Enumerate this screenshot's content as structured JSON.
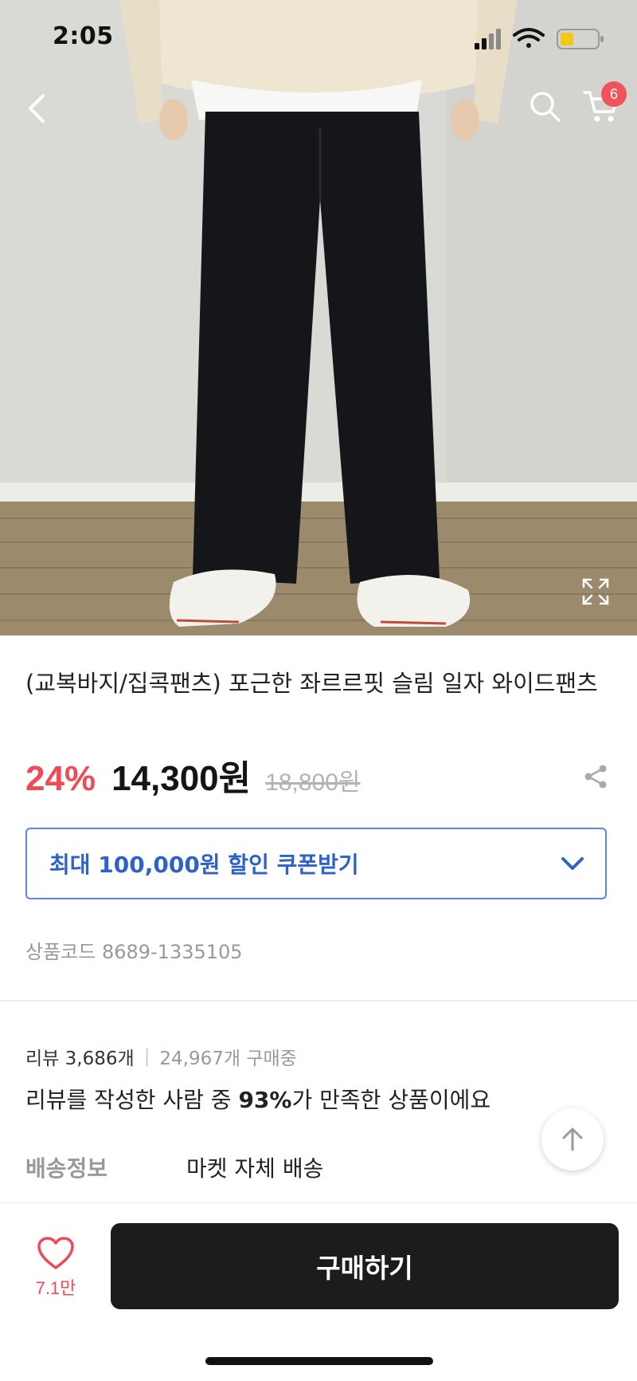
{
  "status_bar": {
    "time": "2:05"
  },
  "header": {
    "back_icon": "chevron-left-icon",
    "search_icon": "search-icon",
    "cart_icon": "cart-icon",
    "cart_count": "6"
  },
  "product": {
    "title": "(교복바지/집콕팬츠) 포근한 좌르르핏 슬림 일자 와이드팬츠",
    "discount": "24%",
    "price": "14,300원",
    "original_price": "18,800원",
    "coupon_label": "최대 100,000원 할인 쿠폰받기",
    "product_code": "상품코드 8689-1335105"
  },
  "reviews": {
    "review_count": "리뷰 3,686개",
    "separator": "|",
    "buyers": "24,967개 구매중",
    "satisfaction_prefix": "리뷰를 작성한 사람 중 ",
    "satisfaction_percent": "93%",
    "satisfaction_suffix": "가 만족한 상품이에요"
  },
  "shipping": {
    "label": "배송정보",
    "value": "마켓 자체 배송"
  },
  "bottom_bar": {
    "like_count": "7.1만",
    "buy_label": "구매하기"
  },
  "colors": {
    "accent_red": "#ef4a56",
    "coupon_blue": "#2d62c9",
    "buy_button": "#1c1c1c"
  }
}
